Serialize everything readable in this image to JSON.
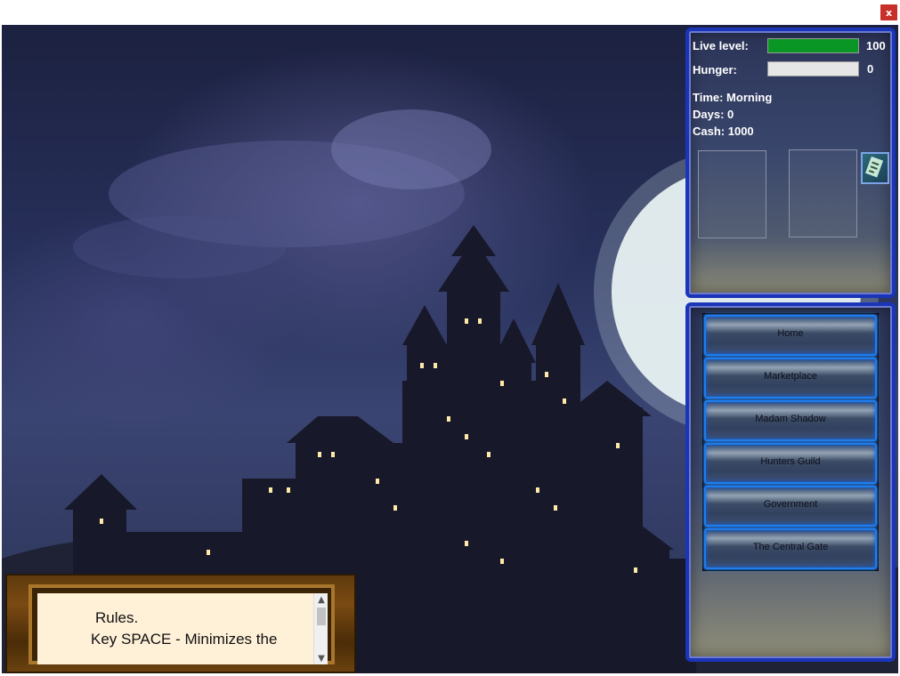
{
  "window": {
    "close_glyph": "x"
  },
  "status": {
    "live_level_label": "Live level:",
    "live_level_value": "100",
    "live_level_fraction": 1.0,
    "hunger_label": "Hunger:",
    "hunger_value": "0",
    "hunger_fraction": 0.0,
    "time_text": "Time: Morning",
    "days_text": "Days: 0",
    "cash_text": "Cash: 1000",
    "item_icon": "scroll-map-icon"
  },
  "nav": {
    "items": [
      "Home",
      "Marketplace",
      "Madam Shadow",
      "Hunters Guild",
      "Government",
      "The Central Gate"
    ]
  },
  "rules": {
    "title": "Rules.",
    "line1": "Key SPACE - Minimizes the"
  },
  "colors": {
    "panel_border": "#1a35b8",
    "live_bar": "#0a9624",
    "nav_glow": "#1d7df0"
  }
}
